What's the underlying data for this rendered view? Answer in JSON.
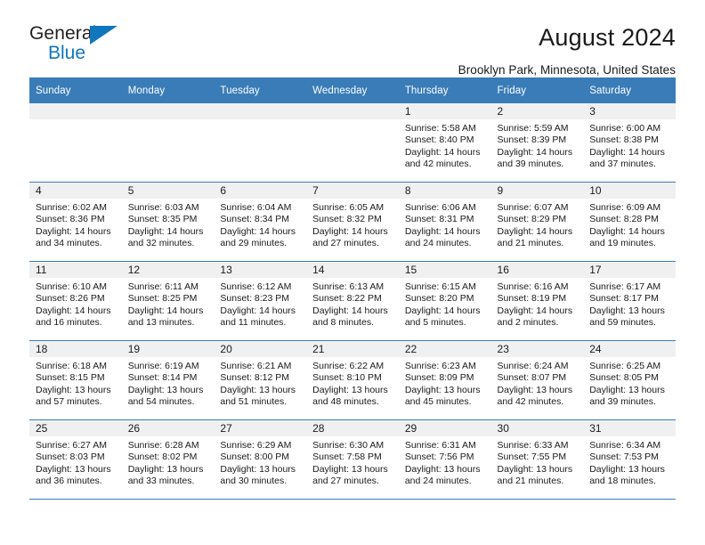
{
  "brand": {
    "name_top": "General",
    "name_bottom": "Blue",
    "color_dark": "#231f20",
    "color_blue": "#1077bc"
  },
  "header": {
    "title": "August 2024",
    "subtitle": "Brooklyn Park, Minnesota, United States",
    "accent_color": "#3a7cb8"
  },
  "weekday_headers": [
    "Sunday",
    "Monday",
    "Tuesday",
    "Wednesday",
    "Thursday",
    "Friday",
    "Saturday"
  ],
  "labels": {
    "sunrise": "Sunrise:",
    "sunset": "Sunset:",
    "daylight": "Daylight:"
  },
  "weeks": [
    [
      {
        "day": "",
        "empty": true
      },
      {
        "day": "",
        "empty": true
      },
      {
        "day": "",
        "empty": true
      },
      {
        "day": "",
        "empty": true
      },
      {
        "day": "1",
        "sunrise": "Sunrise: 5:58 AM",
        "sunset": "Sunset: 8:40 PM",
        "daylight_1": "Daylight: 14 hours",
        "daylight_2": "and 42 minutes."
      },
      {
        "day": "2",
        "sunrise": "Sunrise: 5:59 AM",
        "sunset": "Sunset: 8:39 PM",
        "daylight_1": "Daylight: 14 hours",
        "daylight_2": "and 39 minutes."
      },
      {
        "day": "3",
        "sunrise": "Sunrise: 6:00 AM",
        "sunset": "Sunset: 8:38 PM",
        "daylight_1": "Daylight: 14 hours",
        "daylight_2": "and 37 minutes."
      }
    ],
    [
      {
        "day": "4",
        "sunrise": "Sunrise: 6:02 AM",
        "sunset": "Sunset: 8:36 PM",
        "daylight_1": "Daylight: 14 hours",
        "daylight_2": "and 34 minutes."
      },
      {
        "day": "5",
        "sunrise": "Sunrise: 6:03 AM",
        "sunset": "Sunset: 8:35 PM",
        "daylight_1": "Daylight: 14 hours",
        "daylight_2": "and 32 minutes."
      },
      {
        "day": "6",
        "sunrise": "Sunrise: 6:04 AM",
        "sunset": "Sunset: 8:34 PM",
        "daylight_1": "Daylight: 14 hours",
        "daylight_2": "and 29 minutes."
      },
      {
        "day": "7",
        "sunrise": "Sunrise: 6:05 AM",
        "sunset": "Sunset: 8:32 PM",
        "daylight_1": "Daylight: 14 hours",
        "daylight_2": "and 27 minutes."
      },
      {
        "day": "8",
        "sunrise": "Sunrise: 6:06 AM",
        "sunset": "Sunset: 8:31 PM",
        "daylight_1": "Daylight: 14 hours",
        "daylight_2": "and 24 minutes."
      },
      {
        "day": "9",
        "sunrise": "Sunrise: 6:07 AM",
        "sunset": "Sunset: 8:29 PM",
        "daylight_1": "Daylight: 14 hours",
        "daylight_2": "and 21 minutes."
      },
      {
        "day": "10",
        "sunrise": "Sunrise: 6:09 AM",
        "sunset": "Sunset: 8:28 PM",
        "daylight_1": "Daylight: 14 hours",
        "daylight_2": "and 19 minutes."
      }
    ],
    [
      {
        "day": "11",
        "sunrise": "Sunrise: 6:10 AM",
        "sunset": "Sunset: 8:26 PM",
        "daylight_1": "Daylight: 14 hours",
        "daylight_2": "and 16 minutes."
      },
      {
        "day": "12",
        "sunrise": "Sunrise: 6:11 AM",
        "sunset": "Sunset: 8:25 PM",
        "daylight_1": "Daylight: 14 hours",
        "daylight_2": "and 13 minutes."
      },
      {
        "day": "13",
        "sunrise": "Sunrise: 6:12 AM",
        "sunset": "Sunset: 8:23 PM",
        "daylight_1": "Daylight: 14 hours",
        "daylight_2": "and 11 minutes."
      },
      {
        "day": "14",
        "sunrise": "Sunrise: 6:13 AM",
        "sunset": "Sunset: 8:22 PM",
        "daylight_1": "Daylight: 14 hours",
        "daylight_2": "and 8 minutes."
      },
      {
        "day": "15",
        "sunrise": "Sunrise: 6:15 AM",
        "sunset": "Sunset: 8:20 PM",
        "daylight_1": "Daylight: 14 hours",
        "daylight_2": "and 5 minutes."
      },
      {
        "day": "16",
        "sunrise": "Sunrise: 6:16 AM",
        "sunset": "Sunset: 8:19 PM",
        "daylight_1": "Daylight: 14 hours",
        "daylight_2": "and 2 minutes."
      },
      {
        "day": "17",
        "sunrise": "Sunrise: 6:17 AM",
        "sunset": "Sunset: 8:17 PM",
        "daylight_1": "Daylight: 13 hours",
        "daylight_2": "and 59 minutes."
      }
    ],
    [
      {
        "day": "18",
        "sunrise": "Sunrise: 6:18 AM",
        "sunset": "Sunset: 8:15 PM",
        "daylight_1": "Daylight: 13 hours",
        "daylight_2": "and 57 minutes."
      },
      {
        "day": "19",
        "sunrise": "Sunrise: 6:19 AM",
        "sunset": "Sunset: 8:14 PM",
        "daylight_1": "Daylight: 13 hours",
        "daylight_2": "and 54 minutes."
      },
      {
        "day": "20",
        "sunrise": "Sunrise: 6:21 AM",
        "sunset": "Sunset: 8:12 PM",
        "daylight_1": "Daylight: 13 hours",
        "daylight_2": "and 51 minutes."
      },
      {
        "day": "21",
        "sunrise": "Sunrise: 6:22 AM",
        "sunset": "Sunset: 8:10 PM",
        "daylight_1": "Daylight: 13 hours",
        "daylight_2": "and 48 minutes."
      },
      {
        "day": "22",
        "sunrise": "Sunrise: 6:23 AM",
        "sunset": "Sunset: 8:09 PM",
        "daylight_1": "Daylight: 13 hours",
        "daylight_2": "and 45 minutes."
      },
      {
        "day": "23",
        "sunrise": "Sunrise: 6:24 AM",
        "sunset": "Sunset: 8:07 PM",
        "daylight_1": "Daylight: 13 hours",
        "daylight_2": "and 42 minutes."
      },
      {
        "day": "24",
        "sunrise": "Sunrise: 6:25 AM",
        "sunset": "Sunset: 8:05 PM",
        "daylight_1": "Daylight: 13 hours",
        "daylight_2": "and 39 minutes."
      }
    ],
    [
      {
        "day": "25",
        "sunrise": "Sunrise: 6:27 AM",
        "sunset": "Sunset: 8:03 PM",
        "daylight_1": "Daylight: 13 hours",
        "daylight_2": "and 36 minutes."
      },
      {
        "day": "26",
        "sunrise": "Sunrise: 6:28 AM",
        "sunset": "Sunset: 8:02 PM",
        "daylight_1": "Daylight: 13 hours",
        "daylight_2": "and 33 minutes."
      },
      {
        "day": "27",
        "sunrise": "Sunrise: 6:29 AM",
        "sunset": "Sunset: 8:00 PM",
        "daylight_1": "Daylight: 13 hours",
        "daylight_2": "and 30 minutes."
      },
      {
        "day": "28",
        "sunrise": "Sunrise: 6:30 AM",
        "sunset": "Sunset: 7:58 PM",
        "daylight_1": "Daylight: 13 hours",
        "daylight_2": "and 27 minutes."
      },
      {
        "day": "29",
        "sunrise": "Sunrise: 6:31 AM",
        "sunset": "Sunset: 7:56 PM",
        "daylight_1": "Daylight: 13 hours",
        "daylight_2": "and 24 minutes."
      },
      {
        "day": "30",
        "sunrise": "Sunrise: 6:33 AM",
        "sunset": "Sunset: 7:55 PM",
        "daylight_1": "Daylight: 13 hours",
        "daylight_2": "and 21 minutes."
      },
      {
        "day": "31",
        "sunrise": "Sunrise: 6:34 AM",
        "sunset": "Sunset: 7:53 PM",
        "daylight_1": "Daylight: 13 hours",
        "daylight_2": "and 18 minutes."
      }
    ]
  ]
}
